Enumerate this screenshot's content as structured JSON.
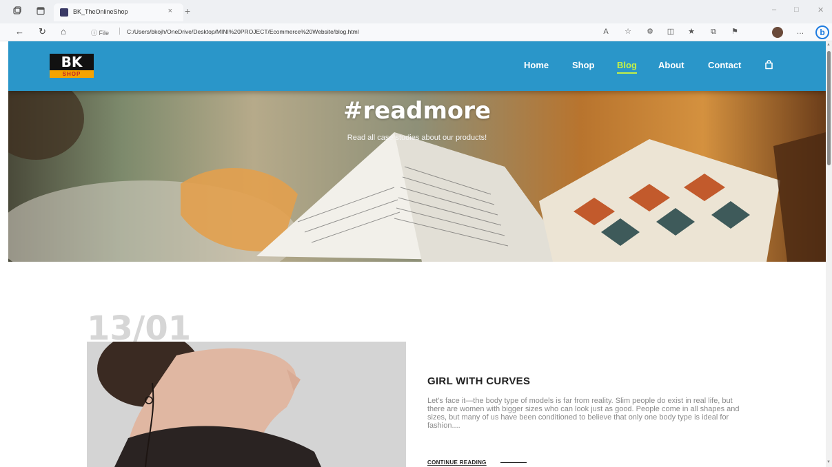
{
  "browser": {
    "tab_title": "BK_TheOnlineShop",
    "tab_close": "×",
    "new_tab": "+",
    "url_info": "ⓘ File",
    "url_separator": "|",
    "url": "C:/Users/bkojh/OneDrive/Desktop/MINI%20PROJECT/Ecommerce%20Website/blog.html",
    "bing": "b"
  },
  "header": {
    "logo_top": "BK",
    "logo_bottom": "SHOP",
    "nav": [
      "Home",
      "Shop",
      "Blog",
      "About",
      "Contact"
    ],
    "active_nav": "Blog",
    "accent": "#c4f046",
    "header_bg": "#2a96c9"
  },
  "hero": {
    "title": "#readmore",
    "subtitle": "Read all case studies about our products!"
  },
  "post": {
    "date": "13/01",
    "title": "GIRL WITH CURVES",
    "excerpt": "Let's face it—the body type of models is far from reality. Slim people do exist in real life, but there are women with bigger sizes who can look just as good. People come in all shapes and sizes, but many of us have been conditioned to believe that only one body type is ideal for fashion....",
    "continue_label": "CONTINUE READING"
  }
}
